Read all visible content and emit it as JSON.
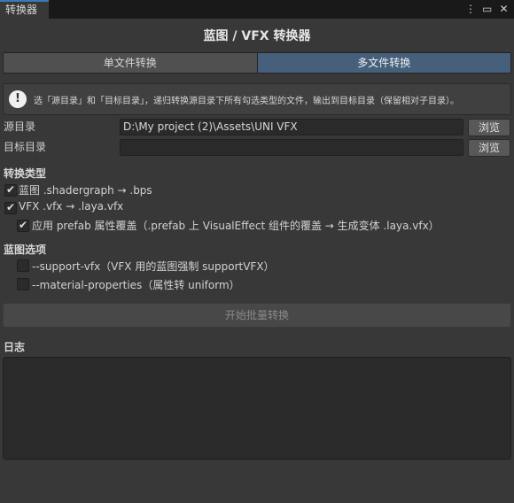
{
  "window": {
    "tab_title": "转换器",
    "menu_icon": "kebab-menu-icon",
    "maximize_icon": "maximize-icon",
    "close_icon": "close-icon"
  },
  "header": {
    "title": "蓝图 / VFX 转换器"
  },
  "mode_tabs": [
    {
      "label": "单文件转换",
      "active": false
    },
    {
      "label": "多文件转换",
      "active": true
    }
  ],
  "help": {
    "icon": "info-icon",
    "text": "选「源目录」和「目标目录」，递归转换源目录下所有勾选类型的文件，输出到目标目录（保留相对子目录）。"
  },
  "paths": {
    "source_label": "源目录",
    "source_value": "D:\\My project (2)\\Assets\\UNI VFX",
    "target_label": "目标目录",
    "target_value": "",
    "browse_label": "浏览"
  },
  "conversion_types": {
    "title": "转换类型",
    "items": [
      {
        "label": "蓝图  .shadergraph → .bps",
        "checked": true
      },
      {
        "label": "VFX  .vfx → .laya.vfx",
        "checked": true
      },
      {
        "label": "应用 prefab 属性覆盖（.prefab 上 VisualEffect 组件的覆盖 → 生成变体 .laya.vfx）",
        "checked": true
      }
    ]
  },
  "blueprint_options": {
    "title": "蓝图选项",
    "items": [
      {
        "label": "--support-vfx（VFX 用的蓝图强制 supportVFX）",
        "checked": false
      },
      {
        "label": "--material-properties（属性转 uniform）",
        "checked": false
      }
    ]
  },
  "actions": {
    "start_batch_label": "开始批量转换"
  },
  "log": {
    "title": "日志",
    "content": ""
  }
}
